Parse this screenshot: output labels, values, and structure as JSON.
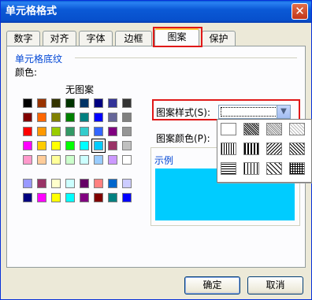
{
  "window": {
    "title": "单元格格式",
    "close_glyph": "✕"
  },
  "tabs": [
    {
      "label": "数字",
      "active": false
    },
    {
      "label": "对齐",
      "active": false
    },
    {
      "label": "字体",
      "active": false
    },
    {
      "label": "边框",
      "active": false
    },
    {
      "label": "图案",
      "active": true
    },
    {
      "label": "保护",
      "active": false
    }
  ],
  "shading": {
    "group_title": "单元格底纹",
    "color_label": "颜色:",
    "no_pattern_label": "无图案",
    "palette_main": [
      [
        "#000000",
        "#993300",
        "#333300",
        "#003300",
        "#003366",
        "#000080",
        "#333399",
        "#333333"
      ],
      [
        "#800000",
        "#ff6600",
        "#808000",
        "#008000",
        "#008080",
        "#0000ff",
        "#666699",
        "#808080"
      ],
      [
        "#ff0000",
        "#ff9900",
        "#99cc00",
        "#339966",
        "#33cccc",
        "#3366ff",
        "#800080",
        "#969696"
      ],
      [
        "#ff00ff",
        "#ffcc00",
        "#ffff00",
        "#00ff00",
        "#00ffff",
        "#00ccff",
        "#993366",
        "#c0c0c0"
      ],
      [
        "#ff99cc",
        "#ffcc99",
        "#ffff99",
        "#ccffcc",
        "#ccffff",
        "#99ccff",
        "#cc99ff",
        "#ffffff"
      ]
    ],
    "palette_extra": [
      [
        "#9999ff",
        "#993366",
        "#ffffcc",
        "#ccffff",
        "#660066",
        "#ff8080",
        "#0066cc",
        "#ccccff"
      ],
      [
        "#000080",
        "#ff00ff",
        "#ffff00",
        "#00ffff",
        "#800080",
        "#800000",
        "#008080",
        "#0000ff"
      ]
    ],
    "selected_color": "#00ccff"
  },
  "pattern": {
    "style_label": "图案样式(S):",
    "color_label": "图案颜色(P):",
    "sample_label": "示例",
    "sample_color": "#00ccff",
    "dropdown_icon": "chevron-down-icon"
  },
  "buttons": {
    "ok": "确定",
    "cancel": "取消"
  }
}
